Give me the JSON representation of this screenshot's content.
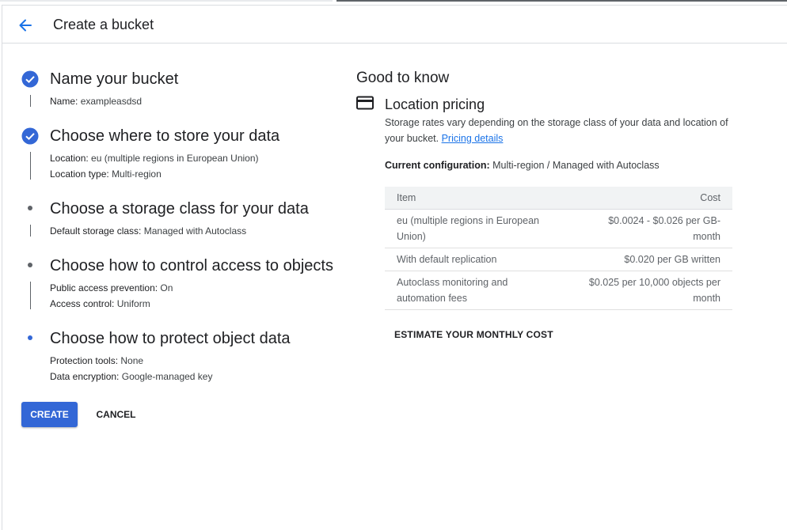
{
  "header": {
    "title": "Create a bucket"
  },
  "steps": [
    {
      "title": "Name your bucket",
      "status": "complete",
      "details": [
        {
          "label": "Name:",
          "value": "exampleasdsd"
        }
      ]
    },
    {
      "title": "Choose where to store your data",
      "status": "complete",
      "details": [
        {
          "label": "Location:",
          "value": "eu (multiple regions in European Union)"
        },
        {
          "label": "Location type:",
          "value": "Multi-region"
        }
      ]
    },
    {
      "title": "Choose a storage class for your data",
      "status": "pending",
      "details": [
        {
          "label": "Default storage class:",
          "value": "Managed with Autoclass"
        }
      ]
    },
    {
      "title": "Choose how to control access to objects",
      "status": "pending",
      "details": [
        {
          "label": "Public access prevention:",
          "value": "On"
        },
        {
          "label": "Access control:",
          "value": "Uniform"
        }
      ]
    },
    {
      "title": "Choose how to protect object data",
      "status": "active",
      "details": [
        {
          "label": "Protection tools:",
          "value": "None"
        },
        {
          "label": "Data encryption:",
          "value": "Google-managed key"
        }
      ]
    }
  ],
  "actions": {
    "create": "CREATE",
    "cancel": "CANCEL"
  },
  "good_to_know": {
    "title": "Good to know",
    "section_title": "Location pricing",
    "description": "Storage rates vary depending on the storage class of your data and location of your bucket.",
    "link": "Pricing details",
    "config_label": "Current configuration:",
    "config_value": "Multi-region / Managed with Autoclass",
    "table": {
      "headers": [
        "Item",
        "Cost"
      ],
      "rows": [
        [
          "eu (multiple regions in European Union)",
          "$0.0024 - $0.026 per GB-month"
        ],
        [
          "With default replication",
          "$0.020 per GB written"
        ],
        [
          "Autoclass monitoring and automation fees",
          "$0.025 per 10,000 objects per month"
        ]
      ]
    },
    "estimate": "ESTIMATE YOUR MONTHLY COST"
  },
  "colors": {
    "accent": "#1a73e8",
    "primary_button": "#3367d6",
    "step_complete": "#3367d6",
    "step_pending": "#5f6368"
  }
}
